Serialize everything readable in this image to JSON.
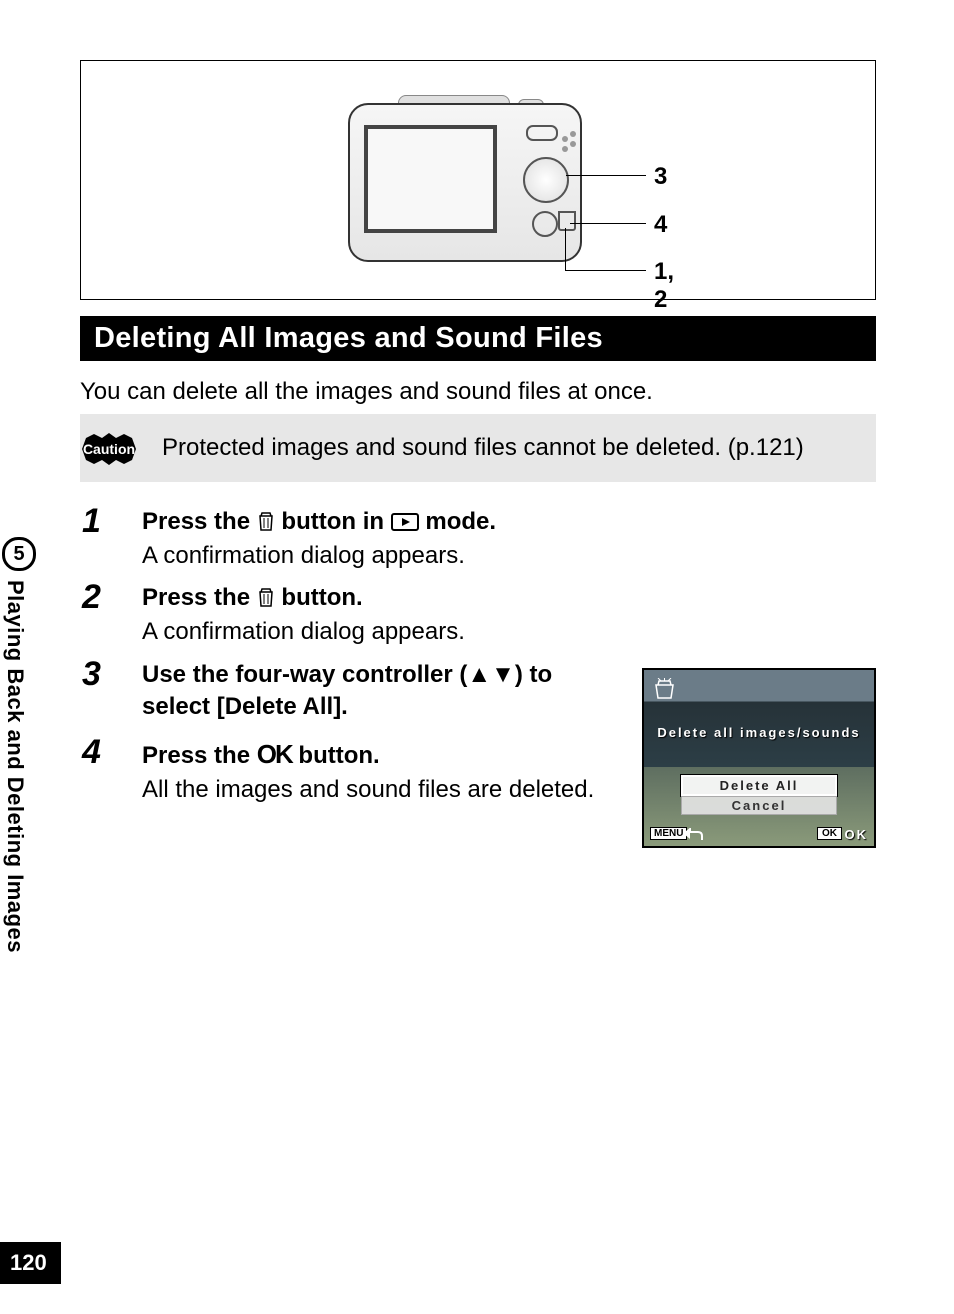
{
  "chapter_number": "5",
  "side_text": "Playing Back and Deleting Images",
  "page_number": "120",
  "callout_labels": {
    "l1": "3",
    "l2": "4",
    "l3": "1, 2"
  },
  "section_title": "Deleting All Images and Sound Files",
  "intro": "You can delete all the images and sound files at once.",
  "caution_label": "Caution",
  "caution_text": "Protected images and sound files cannot be deleted. (p.121)",
  "steps": {
    "s1": {
      "num": "1",
      "head_a": "Press the ",
      "head_b": " button in ",
      "head_c": " mode.",
      "body": "A confirmation dialog appears."
    },
    "s2": {
      "num": "2",
      "head_a": "Press the ",
      "head_b": " button.",
      "body": "A confirmation dialog appears."
    },
    "s3": {
      "num": "3",
      "head": "Use the four-way controller (▲▼) to select [Delete All]."
    },
    "s4": {
      "num": "4",
      "head_a": "Press the ",
      "ok": "OK",
      "head_b": " button.",
      "body": "All the images and sound files are deleted."
    }
  },
  "lcd": {
    "title": "Delete all images/sounds",
    "opt_delete": "Delete All",
    "opt_cancel": "Cancel",
    "menu": "MENU",
    "okbox": "OK",
    "oktxt": "OK"
  }
}
